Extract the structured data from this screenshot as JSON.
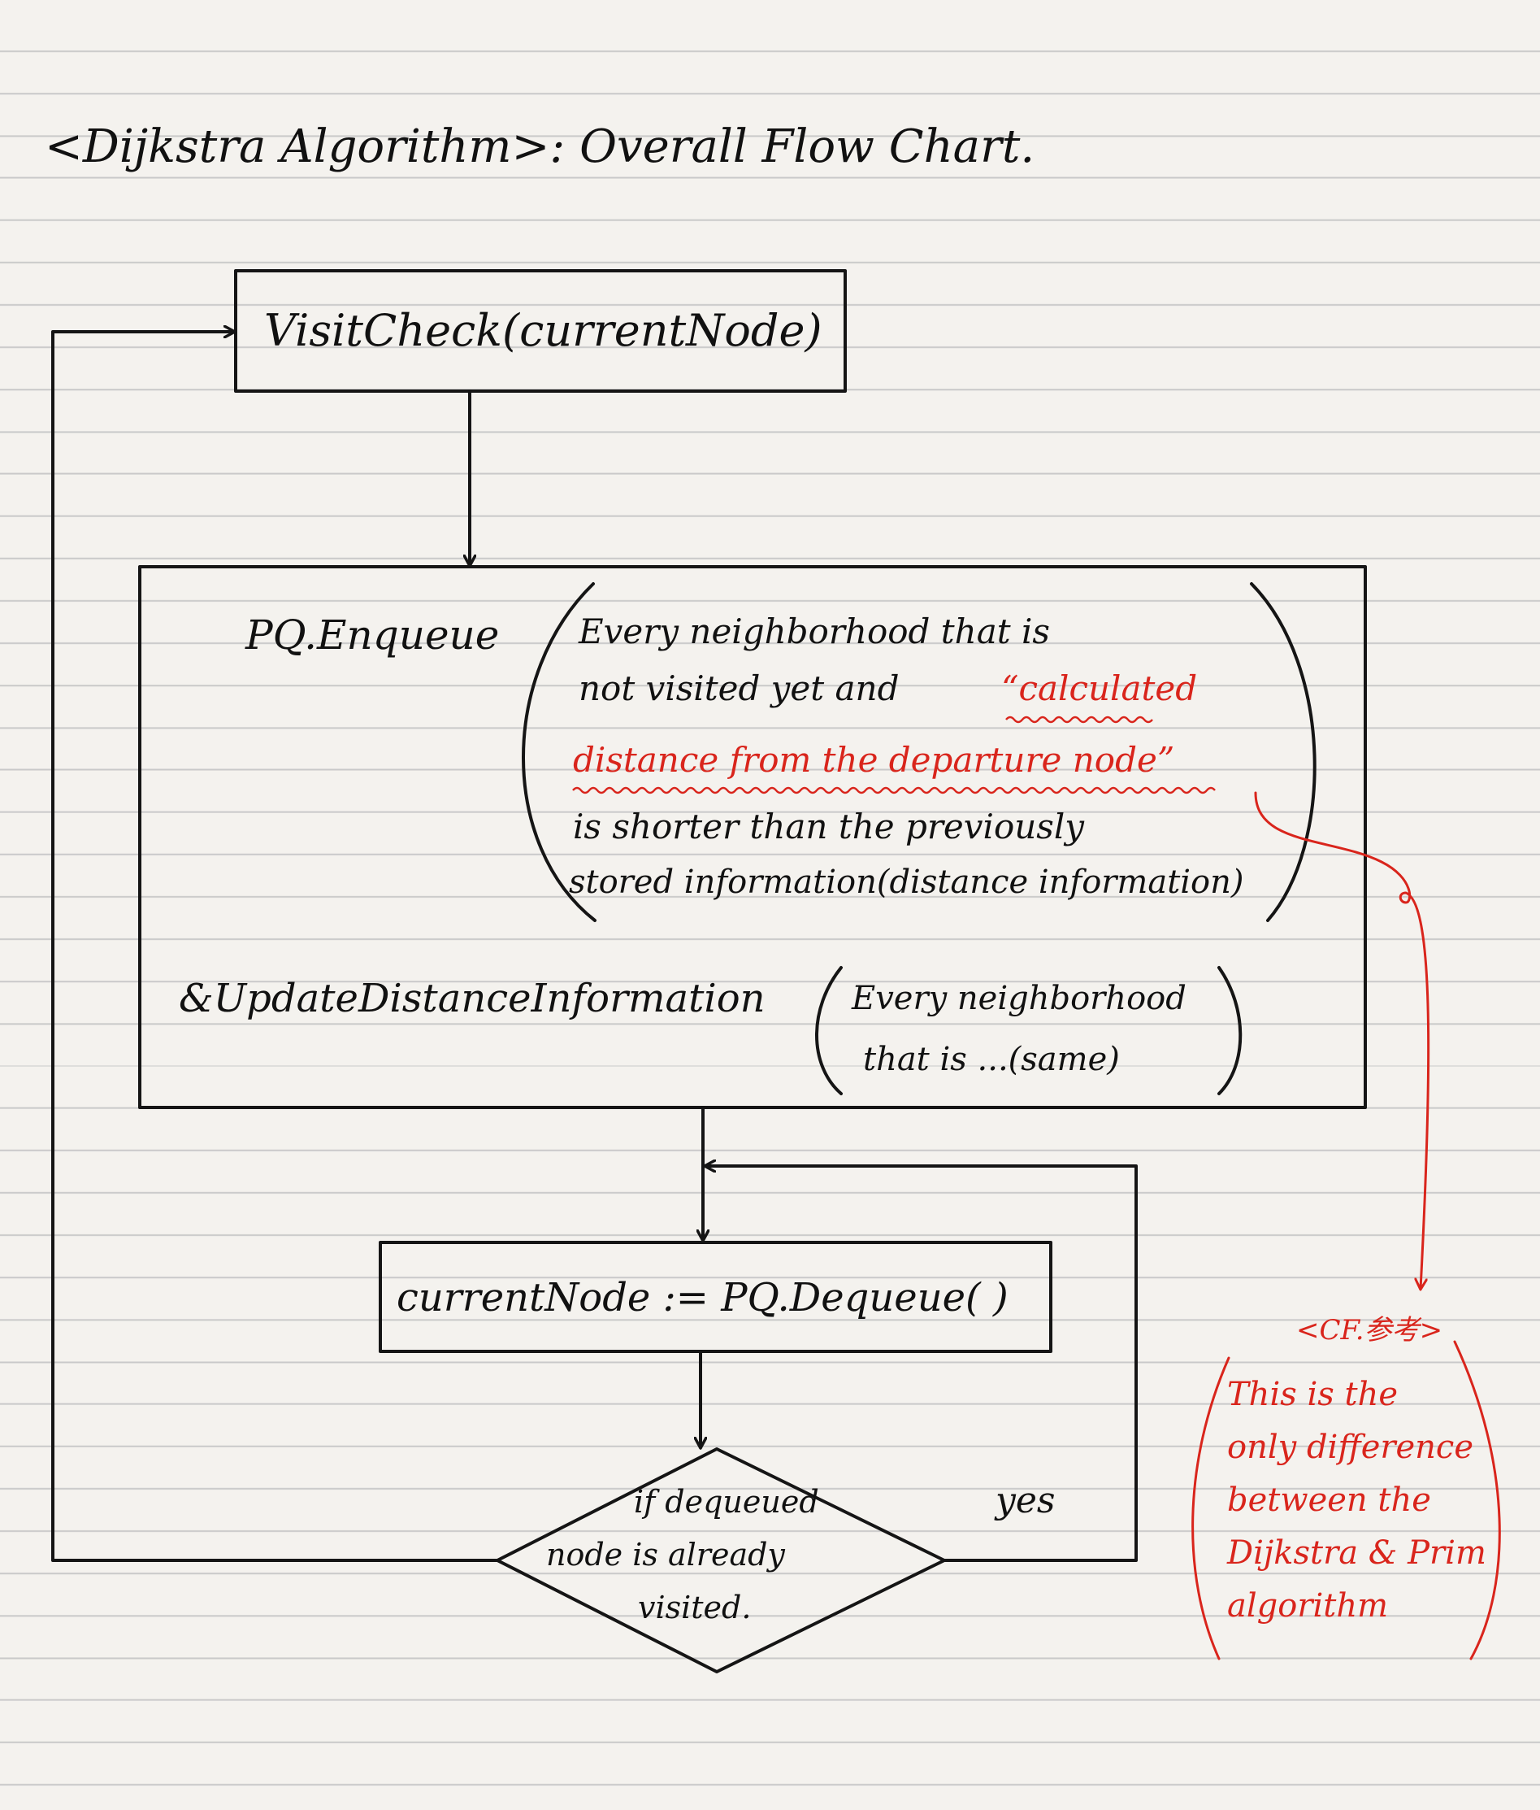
{
  "title": "<Dijkstra Algorithm>: Overall Flow Chart.",
  "nodes": {
    "visit_check": "VisitCheck(currentNode)",
    "pq_enqueue_label": "PQ.Enqueue",
    "enqueue_condition": {
      "line1": "Every neighborhood that is",
      "line2_prefix": "not visited yet and",
      "line2_red": "“calculated",
      "line3_red": "distance from the departure node”",
      "line4": "is shorter than the previously",
      "line5": "stored information(distance information)"
    },
    "update_distance_label": "&UpdateDistanceInformation",
    "update_condition": {
      "line1": "Every neighborhood",
      "line2": "that is ...(same)"
    },
    "dequeue": "currentNode := PQ.Dequeue( )",
    "decision": {
      "line1": "if dequeued",
      "line2": "node is already",
      "line3": "visited."
    },
    "yes_label": "yes"
  },
  "note": {
    "header": "<CF.参考>",
    "lines": [
      "This is the",
      "only difference",
      "between the",
      "Dijkstra & Prim",
      "algorithm"
    ]
  },
  "colors": {
    "ink": "#151515",
    "annotation": "#d9251c",
    "paper": "#f4f2ee",
    "rule_lines": "#c9c9c9"
  }
}
